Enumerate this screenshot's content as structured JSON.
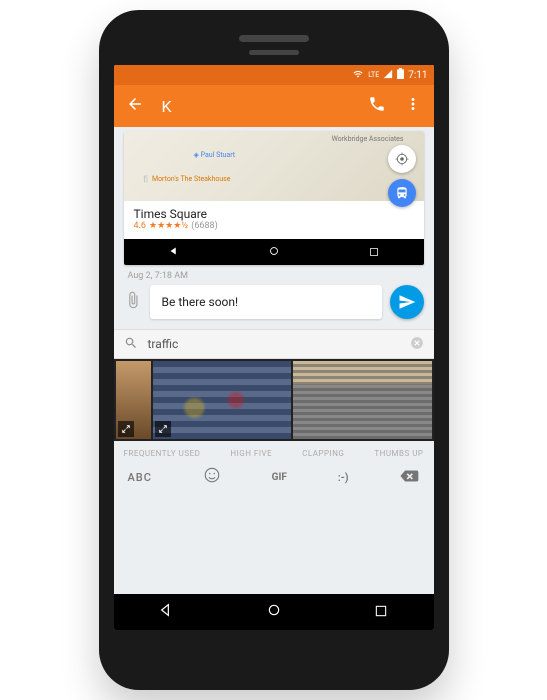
{
  "status": {
    "network": "LTE",
    "time": "7:11"
  },
  "appbar": {
    "title": "K"
  },
  "map": {
    "poi1": "Workbridge Associates",
    "poi2": "Paul Stuart",
    "poi3": "Morton's The Steakhouse"
  },
  "place": {
    "name": "Times Square",
    "rating": "4.6",
    "stars": "★★★★½",
    "reviews": "(6688)"
  },
  "timestamp": "Aug 2, 7:18 AM",
  "compose": {
    "text": "Be there soon!"
  },
  "search": {
    "query": "traffic"
  },
  "categories": [
    "FREQUENTLY USED",
    "HIGH FIVE",
    "CLAPPING",
    "THUMBS UP"
  ],
  "keyboard": {
    "abc": "ABC",
    "gif": "GIF",
    "emoticon": ":-)"
  }
}
